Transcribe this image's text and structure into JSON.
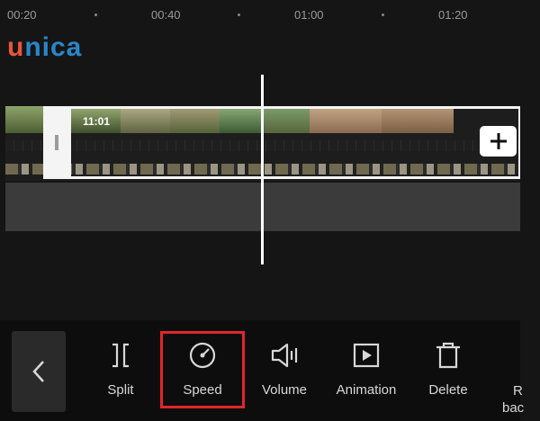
{
  "ruler": {
    "labels": [
      "00:20",
      "00:40",
      "01:00",
      "01:20"
    ]
  },
  "logo": {
    "first_letter": "u",
    "rest": "nica"
  },
  "clip": {
    "duration": "11:01"
  },
  "add_button": {
    "icon": "plus-icon"
  },
  "toolbar": {
    "back_icon": "chevron-left-icon",
    "tools": [
      {
        "label": "Split",
        "icon": "split-icon"
      },
      {
        "label": "Speed",
        "icon": "speed-gauge-icon"
      },
      {
        "label": "Volume",
        "icon": "volume-icon"
      },
      {
        "label": "Animation",
        "icon": "animation-icon"
      },
      {
        "label": "Delete",
        "icon": "trash-icon"
      }
    ],
    "cut_off_label_line1": "R",
    "cut_off_label_line2": "bac",
    "highlighted_tool": "Speed",
    "highlight_color": "#e4242b"
  }
}
